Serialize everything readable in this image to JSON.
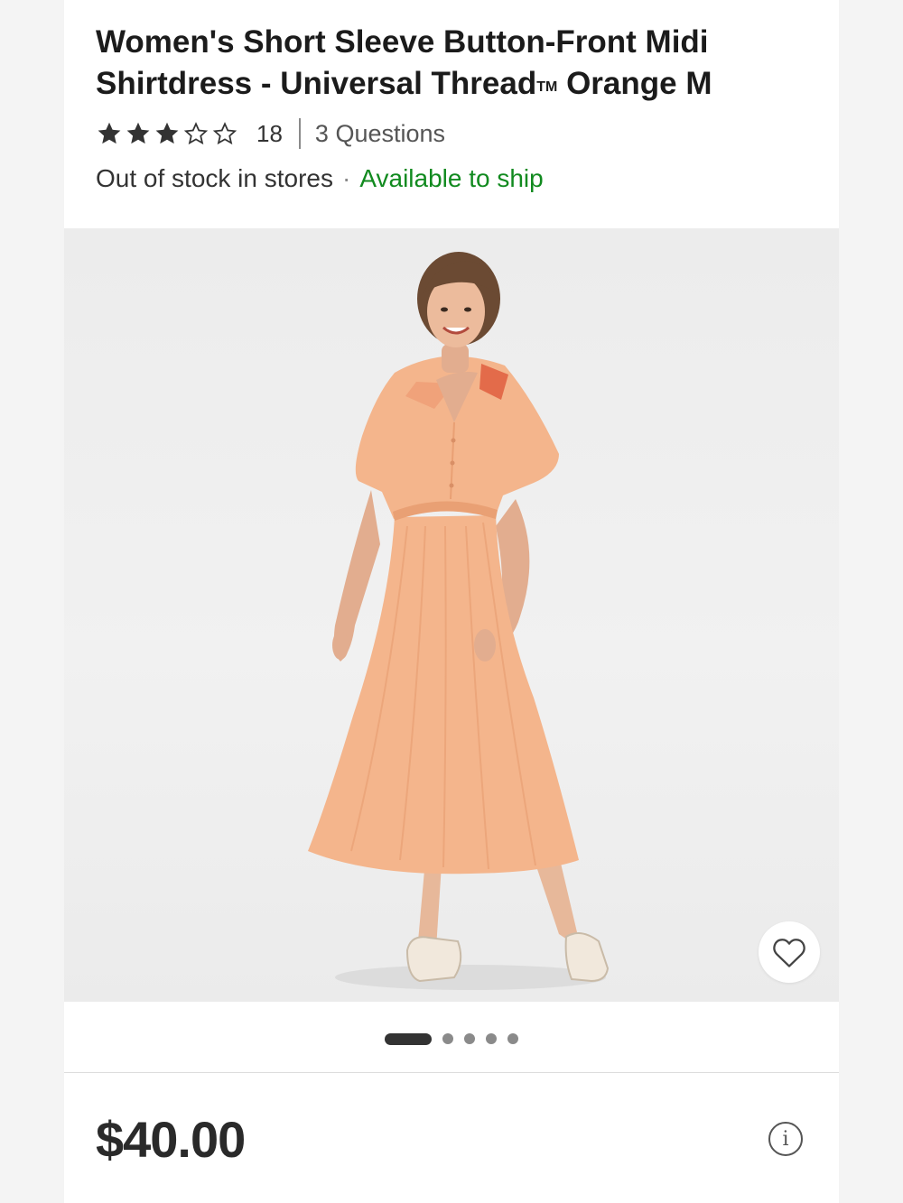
{
  "product": {
    "title_main": "Women's Short Sleeve Button-Front Midi Shirtdress - Universal Thread",
    "title_tm": "TM",
    "title_tail": "Orange M",
    "rating": 3,
    "rating_max": 5,
    "review_count": "18",
    "questions": "3 Questions",
    "stock_status": "Out of stock in stores",
    "stock_separator": "·",
    "ship_status": "Available to ship",
    "price": "$40.00"
  },
  "gallery": {
    "image_count": 5,
    "active_index": 0,
    "favorite_icon": "heart-outline-icon"
  },
  "colors": {
    "ship_green": "#118a1f",
    "dress_peach": "#f4b58c",
    "dress_shade": "#e9a074",
    "collar_red": "#e36b4a",
    "star_fill": "#333333"
  }
}
